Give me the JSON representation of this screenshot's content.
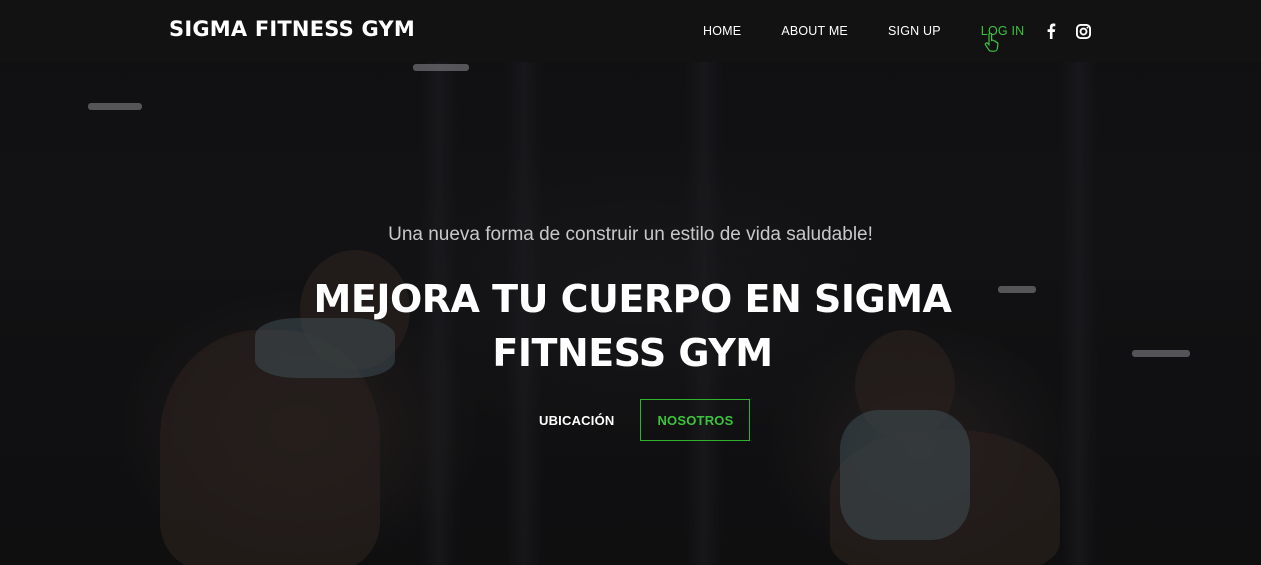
{
  "brand": "SIGMA FITNESS GYM",
  "nav": {
    "items": [
      {
        "label": "HOME",
        "active": false
      },
      {
        "label": "ABOUT ME",
        "active": false
      },
      {
        "label": "SIGN UP",
        "active": false
      },
      {
        "label": "LOG IN",
        "active": true
      }
    ],
    "social": [
      {
        "icon": "facebook-icon"
      },
      {
        "icon": "instagram-icon"
      }
    ]
  },
  "hero": {
    "subtitle": "Una nueva forma de construir un estilo de vida saludable!",
    "title_line1": "MEJORA TU CUERPO EN SIGMA",
    "title_line2": "FITNESS GYM",
    "btn_location": "UBICACIÓN",
    "btn_about": "NOSOTROS"
  },
  "colors": {
    "accent": "#3ec23e",
    "navbar_bg": "#121214",
    "text": "#ffffff"
  }
}
